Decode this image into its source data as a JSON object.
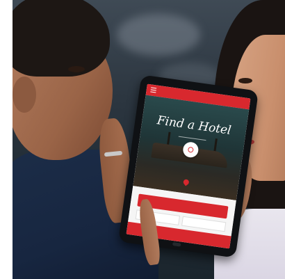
{
  "photo": {
    "subject": "couple-using-tablet",
    "tablet_screen": {
      "title": "Find a Hotel",
      "accent_color": "#d8282e"
    }
  }
}
